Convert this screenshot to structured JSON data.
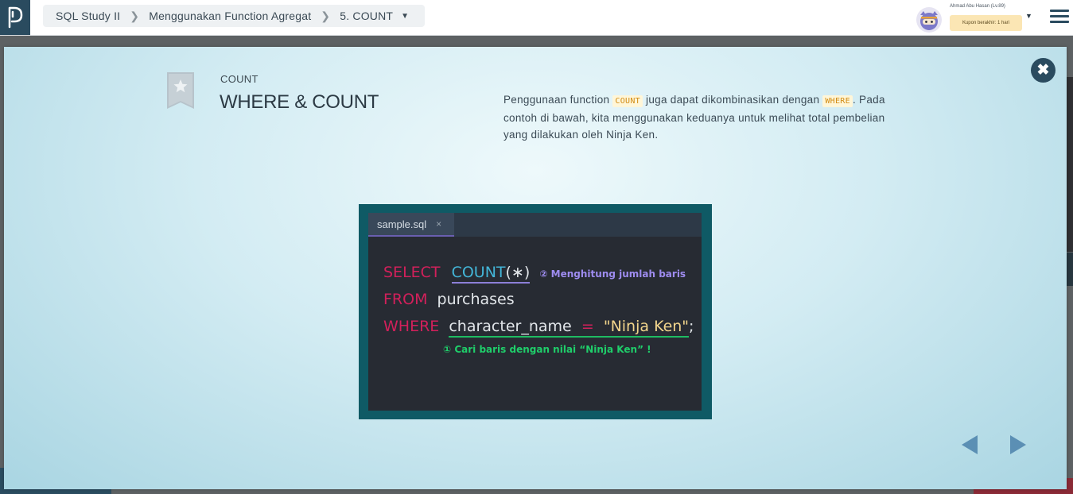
{
  "breadcrumb": {
    "course": "SQL Study II",
    "chapter": "Menggunakan Function Agregat",
    "lesson": "5. COUNT"
  },
  "user": {
    "name": "Ahmad Abu Hasan (Lv.89)",
    "coupon": "Kupon berakhir: 1 hari"
  },
  "slide": {
    "category": "COUNT",
    "title": "WHERE & COUNT",
    "description": {
      "part1": "Penggunaan function ",
      "code1": "COUNT",
      "part2": " juga dapat dikombinasikan dengan ",
      "code2": "WHERE",
      "part3": ". Pada contoh di bawah, kita menggunakan keduanya untuk melihat total pembelian yang dilakukan oleh Ninja Ken."
    }
  },
  "code_image": {
    "tab_name": "sample.sql",
    "tab_close": "×",
    "line1": {
      "keyword": "SELECT",
      "function": "COUNT",
      "args": "(∗)",
      "note": "② Menghitung jumlah baris"
    },
    "line2": {
      "keyword": "FROM",
      "table": "purchases"
    },
    "line3": {
      "keyword": "WHERE",
      "column": "character_name",
      "operator": "=",
      "value": "\"Ninja Ken\"",
      "end": ";"
    },
    "note_green": "① Cari baris dengan nilai “Ninja Ken” !"
  },
  "colors": {
    "brand_dark": "#2a4b5f",
    "keyword_red": "#d2205b",
    "function_blue": "#43b6d8",
    "string_yellow": "#f2d58c",
    "note_purple": "#9e8cf0",
    "note_green": "#1fce6a"
  },
  "icons": {
    "logo": "progate-logo-icon",
    "close": "close-circle-icon",
    "prev": "triangle-left-icon",
    "next": "triangle-right-icon",
    "menu": "hamburger-menu-icon",
    "bookmark": "bookmark-star-icon"
  }
}
